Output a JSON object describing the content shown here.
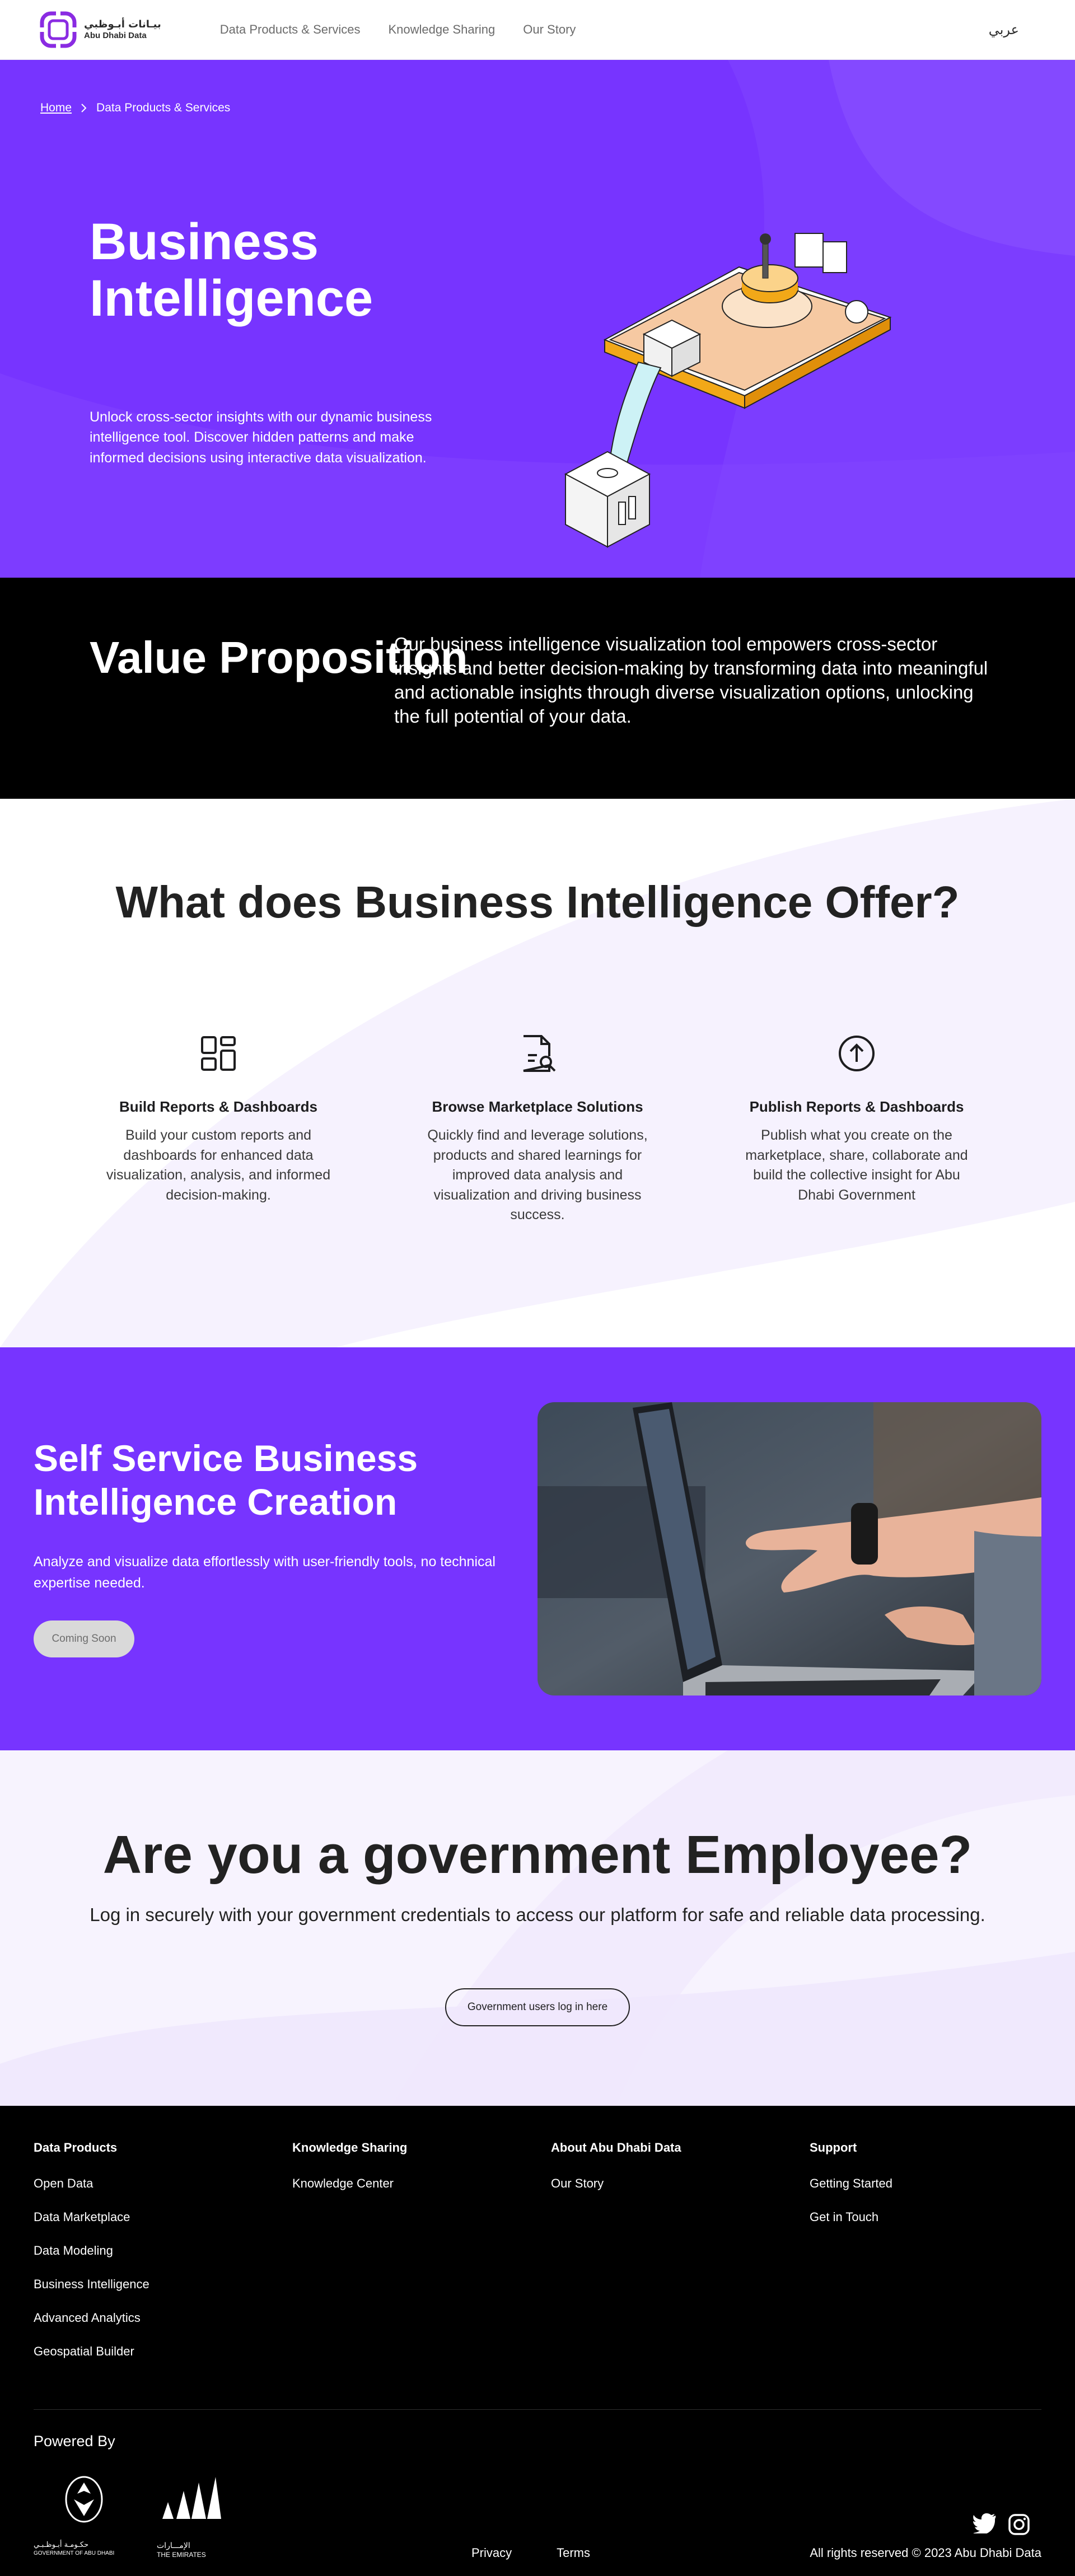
{
  "header": {
    "logo_ar": "بيـانات أبـوظبي",
    "logo_en": "Abu Dhabi Data",
    "nav": [
      "Data Products & Services",
      "Knowledge Sharing",
      "Our Story"
    ],
    "lang": "عربي"
  },
  "hero": {
    "breadcrumb_home": "Home",
    "breadcrumb_current": "Data Products & Services",
    "title": "Business Intelligence",
    "description": "Unlock cross-sector insights with our dynamic business intelligence tool. Discover hidden patterns and make informed decisions using interactive data visualization."
  },
  "value": {
    "title": "Value Proposition",
    "text": "Our business intelligence visualization tool empowers cross-sector insights and better decision-making by transforming data into meaningful and actionable insights through diverse visualization options, unlocking the full potential of your data."
  },
  "offer": {
    "title": "What does Business Intelligence Offer?",
    "items": [
      {
        "icon": "dashboard-grid-icon",
        "title": "Build Reports & Dashboards",
        "text": "Build your custom reports and dashboards for enhanced data visualization, analysis, and informed decision-making."
      },
      {
        "icon": "document-search-icon",
        "title": "Browse Marketplace Solutions",
        "text": "Quickly find and leverage solutions, products and shared learnings for improved data analysis and visualization and driving business success."
      },
      {
        "icon": "upload-circle-icon",
        "title": "Publish Reports & Dashboards",
        "text": "Publish what you create on the marketplace, share, collaborate and build the collective insight for Abu Dhabi Government"
      }
    ]
  },
  "selfservice": {
    "title": "Self Service Business Intelligence Creation",
    "description": "Analyze and visualize data effortlessly with user-friendly tools, no technical expertise needed.",
    "button": "Coming Soon"
  },
  "gov": {
    "title": "Are you a government Employee?",
    "description": "Log in securely with your government credentials to access our platform for safe and reliable data processing.",
    "button": "Government users log in here"
  },
  "footer": {
    "columns": [
      {
        "title": "Data Products",
        "links": [
          "Open Data",
          "Data Marketplace",
          "Data Modeling",
          "Business Intelligence",
          "Advanced Analytics",
          "Geospatial Builder"
        ]
      },
      {
        "title": "Knowledge Sharing",
        "links": [
          "Knowledge Center"
        ]
      },
      {
        "title": "About Abu Dhabi Data",
        "links": [
          "Our Story"
        ]
      },
      {
        "title": "Support",
        "links": [
          "Getting Started",
          "Get in Touch"
        ]
      }
    ],
    "powered_by": "Powered By",
    "adgov_ar": "حكـومـة أبـوظـبـي",
    "adgov_en": "GOVERNMENT OF ABU DHABI",
    "uae_ar": "الإمـــارات",
    "uae_en": "THE EMIRATES",
    "privacy": "Privacy",
    "terms": "Terms",
    "copyright": "All rights reserved © 2023 Abu Dhabi Data"
  },
  "colors": {
    "brand_purple": "#7734ff",
    "logo_purple": "#8a2be2",
    "black": "#000000"
  }
}
